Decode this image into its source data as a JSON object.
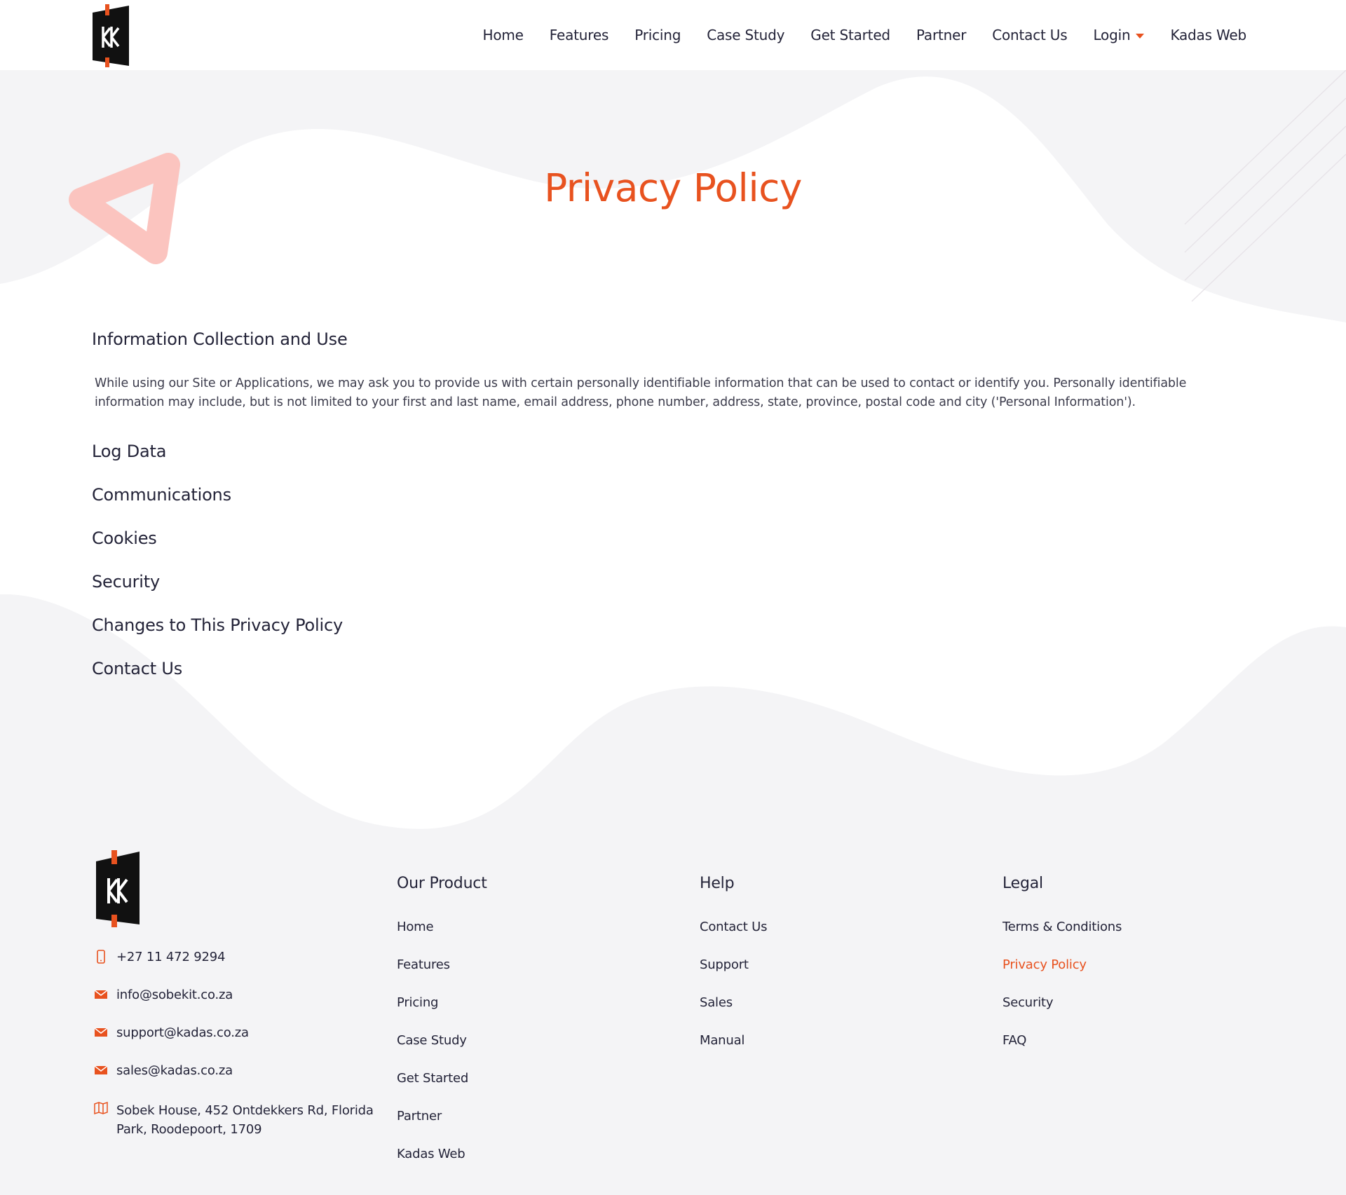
{
  "brand": {
    "logo_text": "KK",
    "accent": "#e8521f",
    "dark": "#232338"
  },
  "nav": {
    "items": [
      "Home",
      "Features",
      "Pricing",
      "Case Study",
      "Get Started",
      "Partner",
      "Contact Us",
      "Login",
      "Kadas Web"
    ],
    "login_has_dropdown": true
  },
  "main": {
    "title": "Privacy Policy",
    "sections": [
      "Information Collection and Use",
      "Log Data",
      "Communications",
      "Cookies",
      "Security",
      "Changes to This Privacy Policy",
      "Contact Us"
    ],
    "intro_paragraph": "While using our Site or Applications, we may ask you to provide us with certain personally identifiable information that can be used to contact or identify you. Personally identifiable information may include, but is not limited to your first and last name, email address, phone number, address, state, province, postal code and city ('Personal Information')."
  },
  "footer": {
    "contact": {
      "phone": "+27 11 472 9294",
      "emails": [
        "info@sobekit.co.za",
        "support@kadas.co.za",
        "sales@kadas.co.za"
      ],
      "address": "Sobek House, 452 Ontdekkers Rd, Florida Park, Roodepoort, 1709",
      "icons": [
        "phone-icon",
        "mail-icon",
        "mail-icon",
        "mail-icon",
        "map-icon"
      ]
    },
    "columns": [
      {
        "heading": "Our Product",
        "links": [
          "Home",
          "Features",
          "Pricing",
          "Case Study",
          "Get Started",
          "Partner",
          "Kadas Web"
        ]
      },
      {
        "heading": "Help",
        "links": [
          "Contact Us",
          "Support",
          "Sales",
          "Manual"
        ]
      },
      {
        "heading": "Legal",
        "links": [
          "Terms & Conditions",
          "Privacy Policy",
          "Security",
          "FAQ"
        ],
        "active": "Privacy Policy"
      }
    ]
  }
}
